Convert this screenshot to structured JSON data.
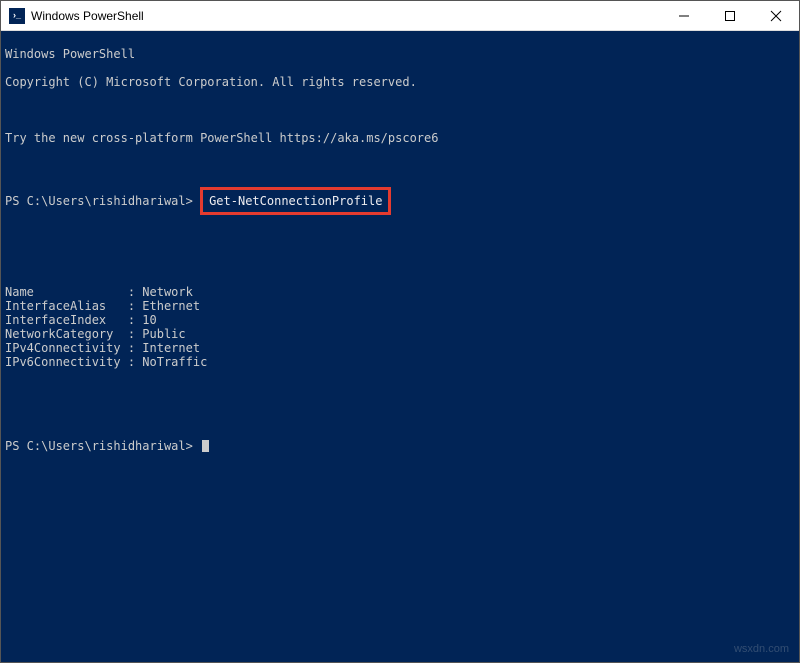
{
  "window": {
    "title": "Windows PowerShell"
  },
  "terminal": {
    "header1": "Windows PowerShell",
    "header2": "Copyright (C) Microsoft Corporation. All rights reserved.",
    "tryline": "Try the new cross-platform PowerShell https://aka.ms/pscore6",
    "prompt1_prefix": "PS C:\\Users\\rishidhariwal> ",
    "command1": "Get-NetConnectionProfile",
    "output": {
      "Name": "Network",
      "InterfaceAlias": "Ethernet",
      "InterfaceIndex": "10",
      "NetworkCategory": "Public",
      "IPv4Connectivity": "Internet",
      "IPv6Connectivity": "NoTraffic"
    },
    "kv_block": "Name             : Network\nInterfaceAlias   : Ethernet\nInterfaceIndex   : 10\nNetworkCategory  : Public\nIPv4Connectivity : Internet\nIPv6Connectivity : NoTraffic",
    "prompt2": "PS C:\\Users\\rishidhariwal> "
  },
  "watermark": "wsxdn.com"
}
